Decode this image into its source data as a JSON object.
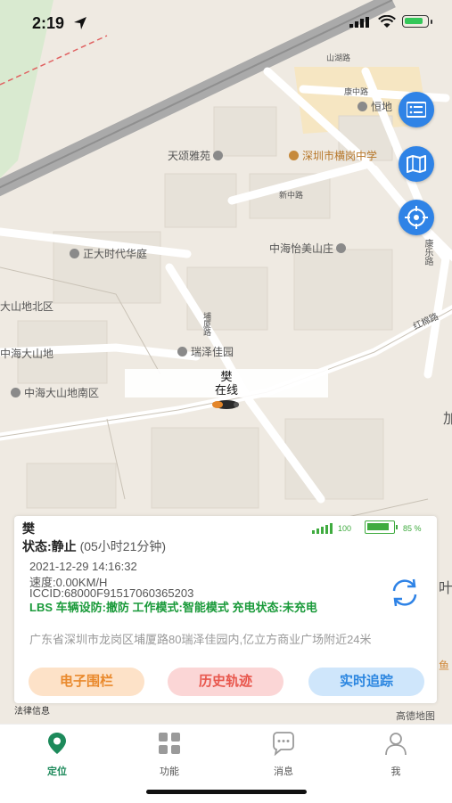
{
  "status_bar": {
    "time": "2:19"
  },
  "map": {
    "labels": {
      "shanhu_road": "山湖路",
      "kangzhong_road": "康中路",
      "hengdi": "恒地",
      "tiansong": "天颂雅苑",
      "school": "深圳市横岗中学",
      "xinzhong_road": "新中路",
      "zhonghai_yimei": "中海怡美山庄",
      "kangle_road": "康乐路",
      "zhengda": "正大时代华庭",
      "dashan_north": "大山地北区",
      "puxia_road": "埔厦路",
      "honghua_road": "红棉路",
      "zhonghai_dashan": "中海大山地",
      "ruize": "瑞泽佳园",
      "dashan_south": "中海大山地南区",
      "edge_jia": "加",
      "edge_ye": "叶",
      "edge_yu": "鱼"
    },
    "vehicle": {
      "name": "樊",
      "status": "在线"
    }
  },
  "panel": {
    "name": "樊",
    "state": "状态:静止",
    "duration": "(05小时21分钟)",
    "signal_value": "100",
    "battery_pct": "85 %",
    "battery_fill": 0.85,
    "datetime": "2021-12-29 14:16:32",
    "speed": "速度:0.00KM/H",
    "iccid": "ICCID:68000F91517060365203",
    "status_line": "LBS  车辆设防:撤防  工作模式:智能模式  充电状态:未充电",
    "address": "广东省深圳市龙岗区埔厦路80瑞泽佳园内,亿立方商业广场附近24米",
    "buttons": {
      "fence": "电子围栏",
      "history": "历史轨迹",
      "track": "实时追踪"
    }
  },
  "map_footer": {
    "legal": "法律信息",
    "provider": "高德地图"
  },
  "tabs": [
    {
      "label": "定位",
      "active": true
    },
    {
      "label": "功能",
      "active": false
    },
    {
      "label": "消息",
      "active": false
    },
    {
      "label": "我",
      "active": false
    }
  ],
  "colors": {
    "accent": "#2f83e6",
    "tab_active": "#1d8a5b",
    "status_green": "#1a9a3a"
  }
}
